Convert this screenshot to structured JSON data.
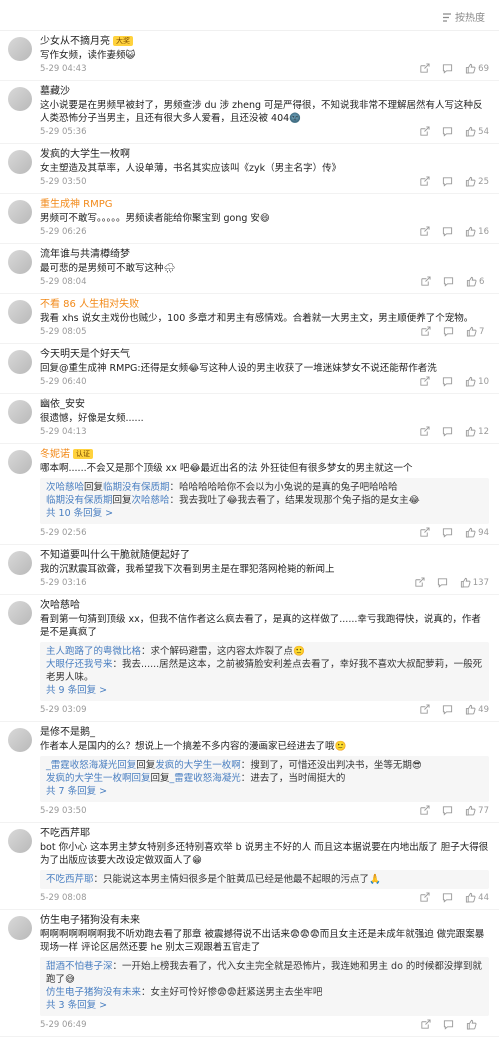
{
  "sort_label": "按热度",
  "reply_prefix": "回复",
  "comments": [
    {
      "name": "少女从不摘月亮",
      "badge": "大奖",
      "text": "写作女频，读作妻频😺",
      "time": "5-29 04:43",
      "likes": "69",
      "orange": false,
      "replies": [],
      "more": ""
    },
    {
      "name": "墓藏沙",
      "badge": "",
      "text": "这小说要是在男频早被封了，男频查涉 du 涉 zheng 可是严得很，不知说我非常不理解居然有人写这种反人类恐怖分子当男主，且还有很大多人爱看，且还没被 404🌚",
      "time": "5-29 05:36",
      "likes": "54",
      "orange": false,
      "replies": [],
      "more": ""
    },
    {
      "name": "发疯的大学生一枚啊",
      "badge": "",
      "text": "女主塑造及其草率，人设单薄，书名其实应该叫《zyk（男主名字）传》",
      "time": "5-29 03:50",
      "likes": "25",
      "orange": false,
      "replies": [],
      "more": ""
    },
    {
      "name": "重生成神 RMPG",
      "badge": "",
      "text": "男频可不敢写。。。。。男频读者能给你聚宝到 gong 安😄",
      "time": "5-29 06:26",
      "likes": "16",
      "orange": true,
      "replies": [],
      "more": ""
    },
    {
      "name": "流年谁与共清樽绮梦",
      "badge": "",
      "text": "最可悲的是男频可不敢写这种🌧",
      "time": "5-29 08:04",
      "likes": "6",
      "orange": false,
      "replies": [],
      "more": ""
    },
    {
      "name": "不看 86 人生相对失败",
      "badge": "",
      "text": "我看 xhs 说女主戏份也贼少，100 多章才和男主有感情戏。合着就一大男主文，男主顺便养了个宠物。",
      "time": "5-29 08:05",
      "likes": "7",
      "orange": true,
      "replies": [],
      "more": ""
    },
    {
      "name": "今天明天是个好天气",
      "badge": "",
      "text": "回复@重生成神 RMPG:还得是女频😂写这种人设的男主收获了一堆迷妹梦女不说还能帮作者洗",
      "time": "5-29 06:40",
      "likes": "10",
      "orange": false,
      "replies": [],
      "more": ""
    },
    {
      "name": "幽依_安安",
      "badge": "",
      "text": "很遗憾，好像是女频......",
      "time": "5-29 04:13",
      "likes": "12",
      "orange": false,
      "replies": [],
      "more": ""
    },
    {
      "name": "冬妮诺",
      "badge": "认证",
      "text": "哪本啊......不会又是那个顶级 xx 吧😂最近出名的法 外狂徒但有很多梦女的男主就这一个",
      "time": "5-29 02:56",
      "likes": "94",
      "orange": true,
      "replies": [
        {
          "who": "次哈慈哈",
          "to": "临期没有保质期",
          "text": "哈哈哈哈哈你不会以为小兔说的是真的兔子吧哈哈哈"
        },
        {
          "who": "临期没有保质期",
          "to": "次哈慈哈",
          "text": "我去我吐了😂我去看了，结果发现那个兔子指的是女主😂"
        }
      ],
      "more": "共 10 条回复 >"
    },
    {
      "name": "不知道要叫什么干脆就随便起好了",
      "badge": "",
      "text": "我的沉默震耳欲聋，我希望我下次看到男主是在罪犯落网枪毙的新闻上",
      "time": "5-29 03:16",
      "likes": "137",
      "orange": false,
      "replies": [],
      "more": ""
    },
    {
      "name": "次哈慈哈",
      "badge": "",
      "text": "看到第一句猜到顶级 xx，但我不信作者这么疯去看了，是真的这样做了......幸亏我跑得快，说真的，作者是不是真疯了",
      "time": "5-29 03:09",
      "likes": "49",
      "orange": false,
      "replies": [
        {
          "who": "主人跑路了的粤微比格",
          "to": "",
          "text": "求个解码避雷，这内容太炸裂了点🙂"
        },
        {
          "who": "大眼仔还我号来",
          "to": "",
          "text": "我去......居然是这本，之前被猜脸安利差点去看了，幸好我不喜欢大叔配萝莉，一般死老男人味。"
        }
      ],
      "more": "共 9 条回复 >"
    },
    {
      "name": "是修不是鹅_",
      "badge": "",
      "text": "作者本人是国内的么？想说上一个搞差不多内容的漫画家已经进去了哦🙂",
      "time": "5-29 03:50",
      "likes": "77",
      "orange": false,
      "replies": [
        {
          "who": "_雷霆收怒海凝光回复",
          "to": "发疯的大学生一枚啊",
          "text": "搜到了，可惜还没出判决书，坐等无期😎"
        },
        {
          "who": "发疯的大学生一枚啊回复",
          "to": "_雷霆收怒海凝光",
          "text": "进去了，当时闹挺大的"
        }
      ],
      "more": "共 7 条回复 >"
    },
    {
      "name": "不吃西芹耶",
      "badge": "",
      "text": "bot 你小心 这本男主梦女特别多还特别喜欢举 b 说男主不好的人 而且这本据说要在内地出版了 胆子大得很 为了出版应该要大改设定做双面人了😁",
      "time": "5-29 08:08",
      "likes": "44",
      "orange": false,
      "replies": [
        {
          "who": "不吃西芹耶",
          "to": "",
          "text": "只能说这本男主情妇很多是个脏黄瓜已经是他最不起眼的污点了🙏"
        }
      ],
      "more": ""
    },
    {
      "name": "仿生电子猪狗没有未来",
      "badge": "",
      "text": "啊啊啊啊啊啊啊我不听劝跑去看了那章 被震撼得说不出话来😨😨😨而且女主还是未成年就强迫 做完跟案暴现场一样 评论区居然还要 he 别太三观跟着五官走了",
      "time": "5-29 06:49",
      "likes": "",
      "orange": false,
      "replies": [
        {
          "who": "甜酒不怕巷子深",
          "to": "",
          "text": "一开始上榜我去看了，代入女主完全就是恐怖片，我连她和男主 do 的时候都没撑到就跑了😅"
        },
        {
          "who": "仿生电子猪狗没有未来",
          "to": "",
          "text": "女主好可怜好惨😨😨赶紧送男主去坐牢吧"
        }
      ],
      "more": "共 3 条回复 >"
    }
  ],
  "colors": {
    "link": "#4a7fc1",
    "vip_name": "#f28a1a",
    "badge": "#ffd23d"
  }
}
